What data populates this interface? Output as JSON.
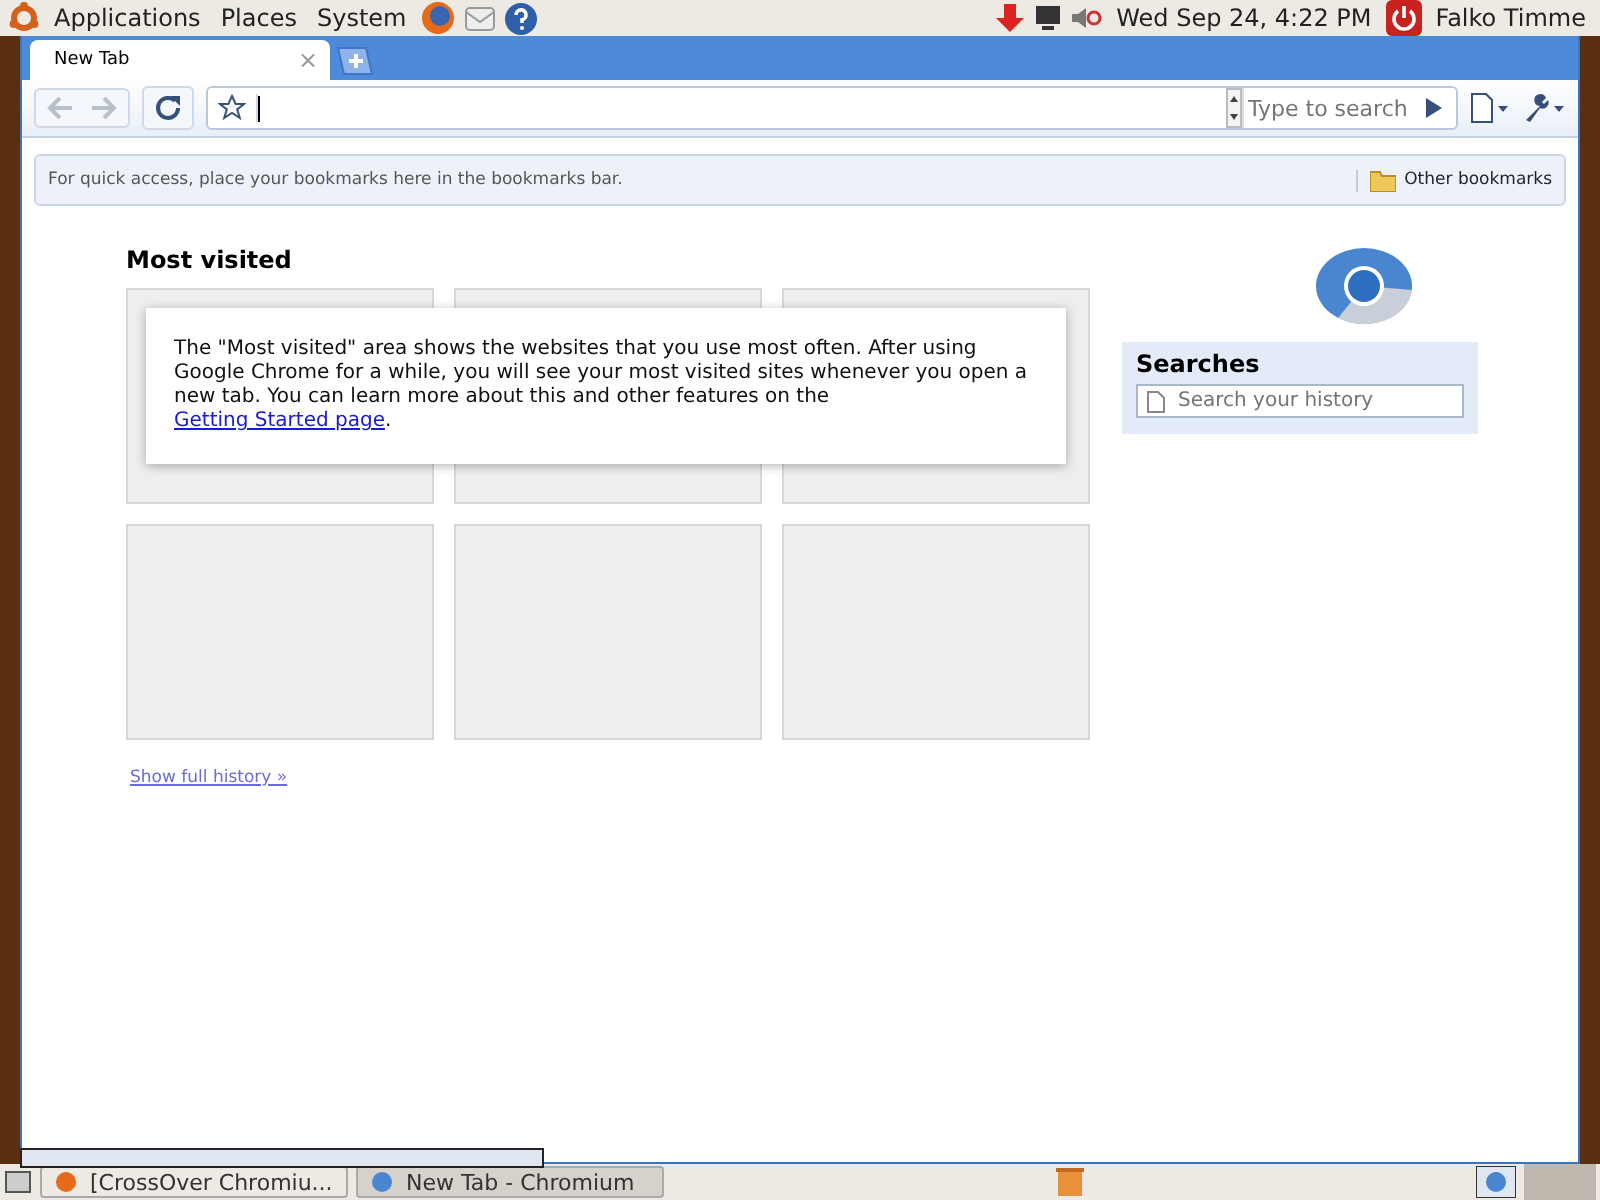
{
  "top_panel": {
    "menus": [
      "Applications",
      "Places",
      "System"
    ],
    "clock": "Wed Sep 24,  4:22 PM",
    "user": "Falko Timme"
  },
  "tabs": [
    {
      "label": "New Tab",
      "selected": true,
      "close": "×"
    }
  ],
  "toolbar": {
    "search_placeholder": "Type to search"
  },
  "bookmarks_bar": {
    "hint": "For quick access, place your bookmarks here in the bookmarks bar.",
    "other": "Other bookmarks"
  },
  "most_visited": {
    "title": "Most visited",
    "notice": "The \"Most visited\" area shows the websites that you use most often. After using Google Chrome for a while, you will see your most visited sites whenever you open a new tab. You can learn more about this and other features on the",
    "link": "Getting Started page",
    "after": ".",
    "history_link": "Show full history »"
  },
  "searches": {
    "title": "Searches",
    "placeholder": "Search your history"
  },
  "taskbar": [
    {
      "label": "[CrossOver Chromiu...",
      "selected": false
    },
    {
      "label": "New Tab - Chromium",
      "selected": true
    }
  ]
}
